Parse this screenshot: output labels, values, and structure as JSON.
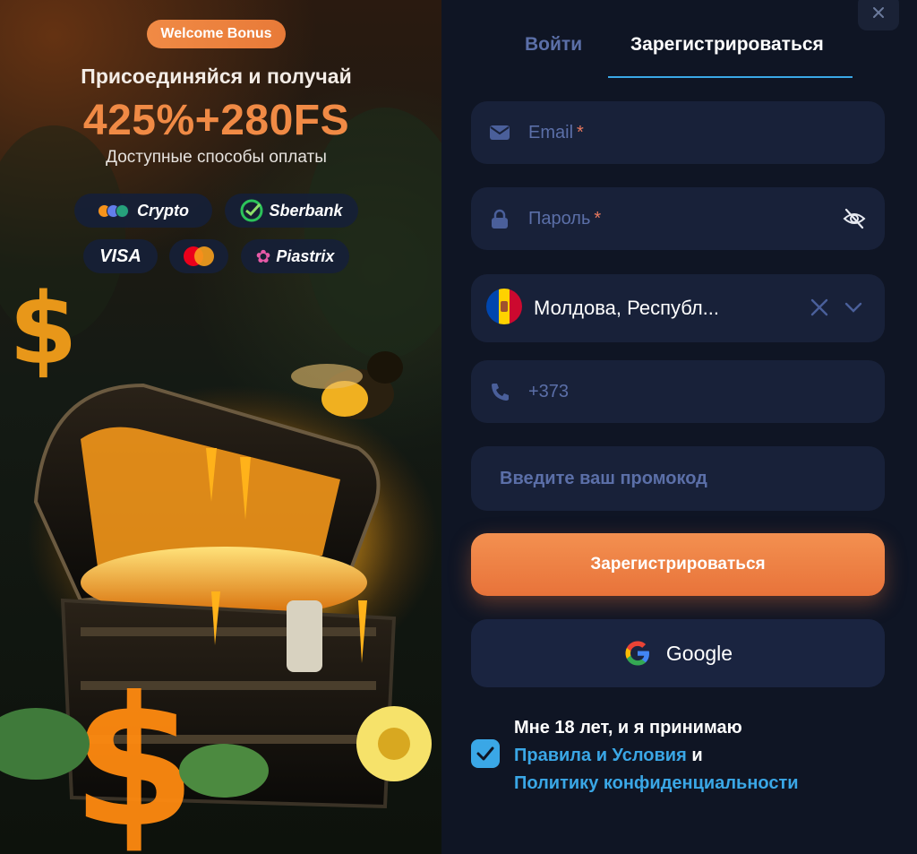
{
  "promo": {
    "welcome_bonus": "Welcome Bonus",
    "headline": "Присоединяйся и получай",
    "bonus": "425%+280FS",
    "payments_caption": "Доступные способы оплаты",
    "payment_methods": [
      "Crypto",
      "Sberbank",
      "VISA",
      "Piastrix"
    ]
  },
  "modal": {
    "close_icon": "close-icon"
  },
  "tabs": {
    "login": "Войти",
    "register": "Зарегистрироваться",
    "active": "register"
  },
  "form": {
    "email_placeholder": "Email",
    "password_placeholder": "Пароль",
    "required_mark": "*",
    "country_value": "Молдова, Республ...",
    "phone_prefix": "+373",
    "promo_placeholder": "Введите ваш промокод",
    "submit_label": "Зарегистрироваться",
    "google_label": "Google"
  },
  "terms": {
    "checked": true,
    "text_start": "Мне 18 лет, и я принимаю",
    "rules_link": "Правила и Условия",
    "and": "и",
    "privacy_link": "Политику конфиденциальности"
  },
  "colors": {
    "accent_orange": "#e8733a",
    "accent_blue": "#3aa7e6",
    "panel_bg": "#0f1524",
    "field_bg": "#182139"
  }
}
